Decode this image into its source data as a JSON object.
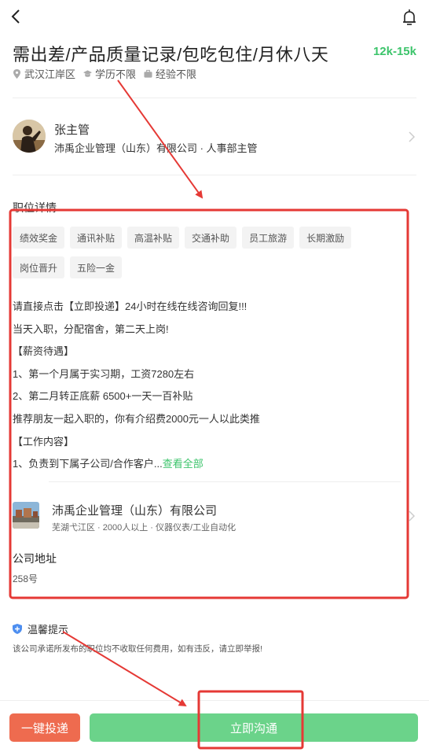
{
  "header": {
    "title": "需出差/产品质量记录/包吃包住/月休八天",
    "salary": "12k-15k",
    "meta": [
      {
        "icon": "location-icon",
        "text": "武汉江岸区"
      },
      {
        "icon": "education-icon",
        "text": "学历不限"
      },
      {
        "icon": "briefcase-icon",
        "text": "经验不限"
      }
    ]
  },
  "recruiter": {
    "name": "张主管",
    "org": "沛禹企业管理（山东）有限公司 · 人事部主管"
  },
  "details": {
    "section_title": "职位详情",
    "tags": [
      "绩效奖金",
      "通讯补贴",
      "高温补贴",
      "交通补助",
      "员工旅游",
      "长期激励",
      "岗位晋升",
      "五险一金"
    ],
    "lines": [
      "请直接点击【立即投递】24小时在线在线咨询回复!!!",
      "当天入职，分配宿舍，第二天上岗!",
      "【薪资待遇】",
      "1、第一个月属于实习期，工资7280左右",
      "2、第二月转正底薪 6500+一天一百补贴",
      "推荐朋友一起入职的，你有介绍费2000元一人以此类推",
      "【工作内容】"
    ],
    "last_line": "1、负责到下属子公司/合作客户...",
    "see_all": "查看全部"
  },
  "company": {
    "name": "沛禹企业管理（山东）有限公司",
    "meta": "芜湖弋江区 · 2000人以上 · 仪器仪表/工业自动化"
  },
  "address": {
    "title": "公司地址",
    "value": "258号"
  },
  "tip": {
    "title": "温馨提示",
    "text": "该公司承诺所发布的职位均不收取任何费用，如有违反，请立即举报!"
  },
  "actions": {
    "apply_label": "一键投递",
    "chat_label": "立即沟通"
  },
  "colors": {
    "salary": "#3cc46b",
    "apply": "#ee6b4f",
    "chat": "#6bd38a",
    "annotation": "#e53935"
  }
}
